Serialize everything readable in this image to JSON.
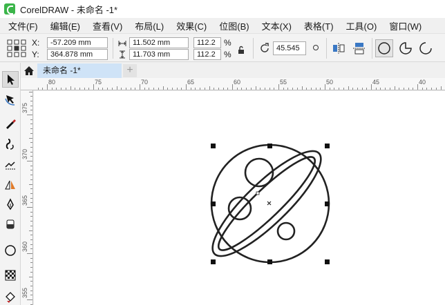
{
  "window": {
    "title": "CorelDRAW - 未命名 -1*"
  },
  "menu": {
    "items": [
      "文件(F)",
      "编辑(E)",
      "查看(V)",
      "布局(L)",
      "效果(C)",
      "位图(B)",
      "文本(X)",
      "表格(T)",
      "工具(O)",
      "窗口(W)"
    ]
  },
  "property_bar": {
    "x_label": "X:",
    "x_value": "-57.209 mm",
    "y_label": "Y:",
    "y_value": "364.878 mm",
    "width_value": "11.502 mm",
    "height_value": "11.703 mm",
    "scale_x": "112.2",
    "scale_y": "112.2",
    "percent": "%",
    "rotation": "45.545"
  },
  "document_tabs": {
    "active": "未命名 -1*",
    "add": "+"
  },
  "rulers": {
    "horizontal": [
      "80",
      "75",
      "70",
      "65",
      "60",
      "55",
      "50",
      "45",
      "40"
    ],
    "vertical": [
      "375",
      "370",
      "365",
      "360",
      "355"
    ]
  },
  "colors": {
    "tab_active": "#cfe3f7",
    "canvas": "#ffffff",
    "stroke": "#222222"
  },
  "icons": [
    "pointer-tool-icon",
    "shape-tool-icon",
    "freehand-tool-icon",
    "artistic-media-icon",
    "smear-tool-icon",
    "mirror-tool-icon",
    "pen-tool-icon",
    "eraser-tool-icon",
    "ellipse-tool-icon",
    "transparency-tool-icon",
    "fill-tool-icon",
    "home-icon",
    "lock-icon",
    "rotate-icon"
  ]
}
